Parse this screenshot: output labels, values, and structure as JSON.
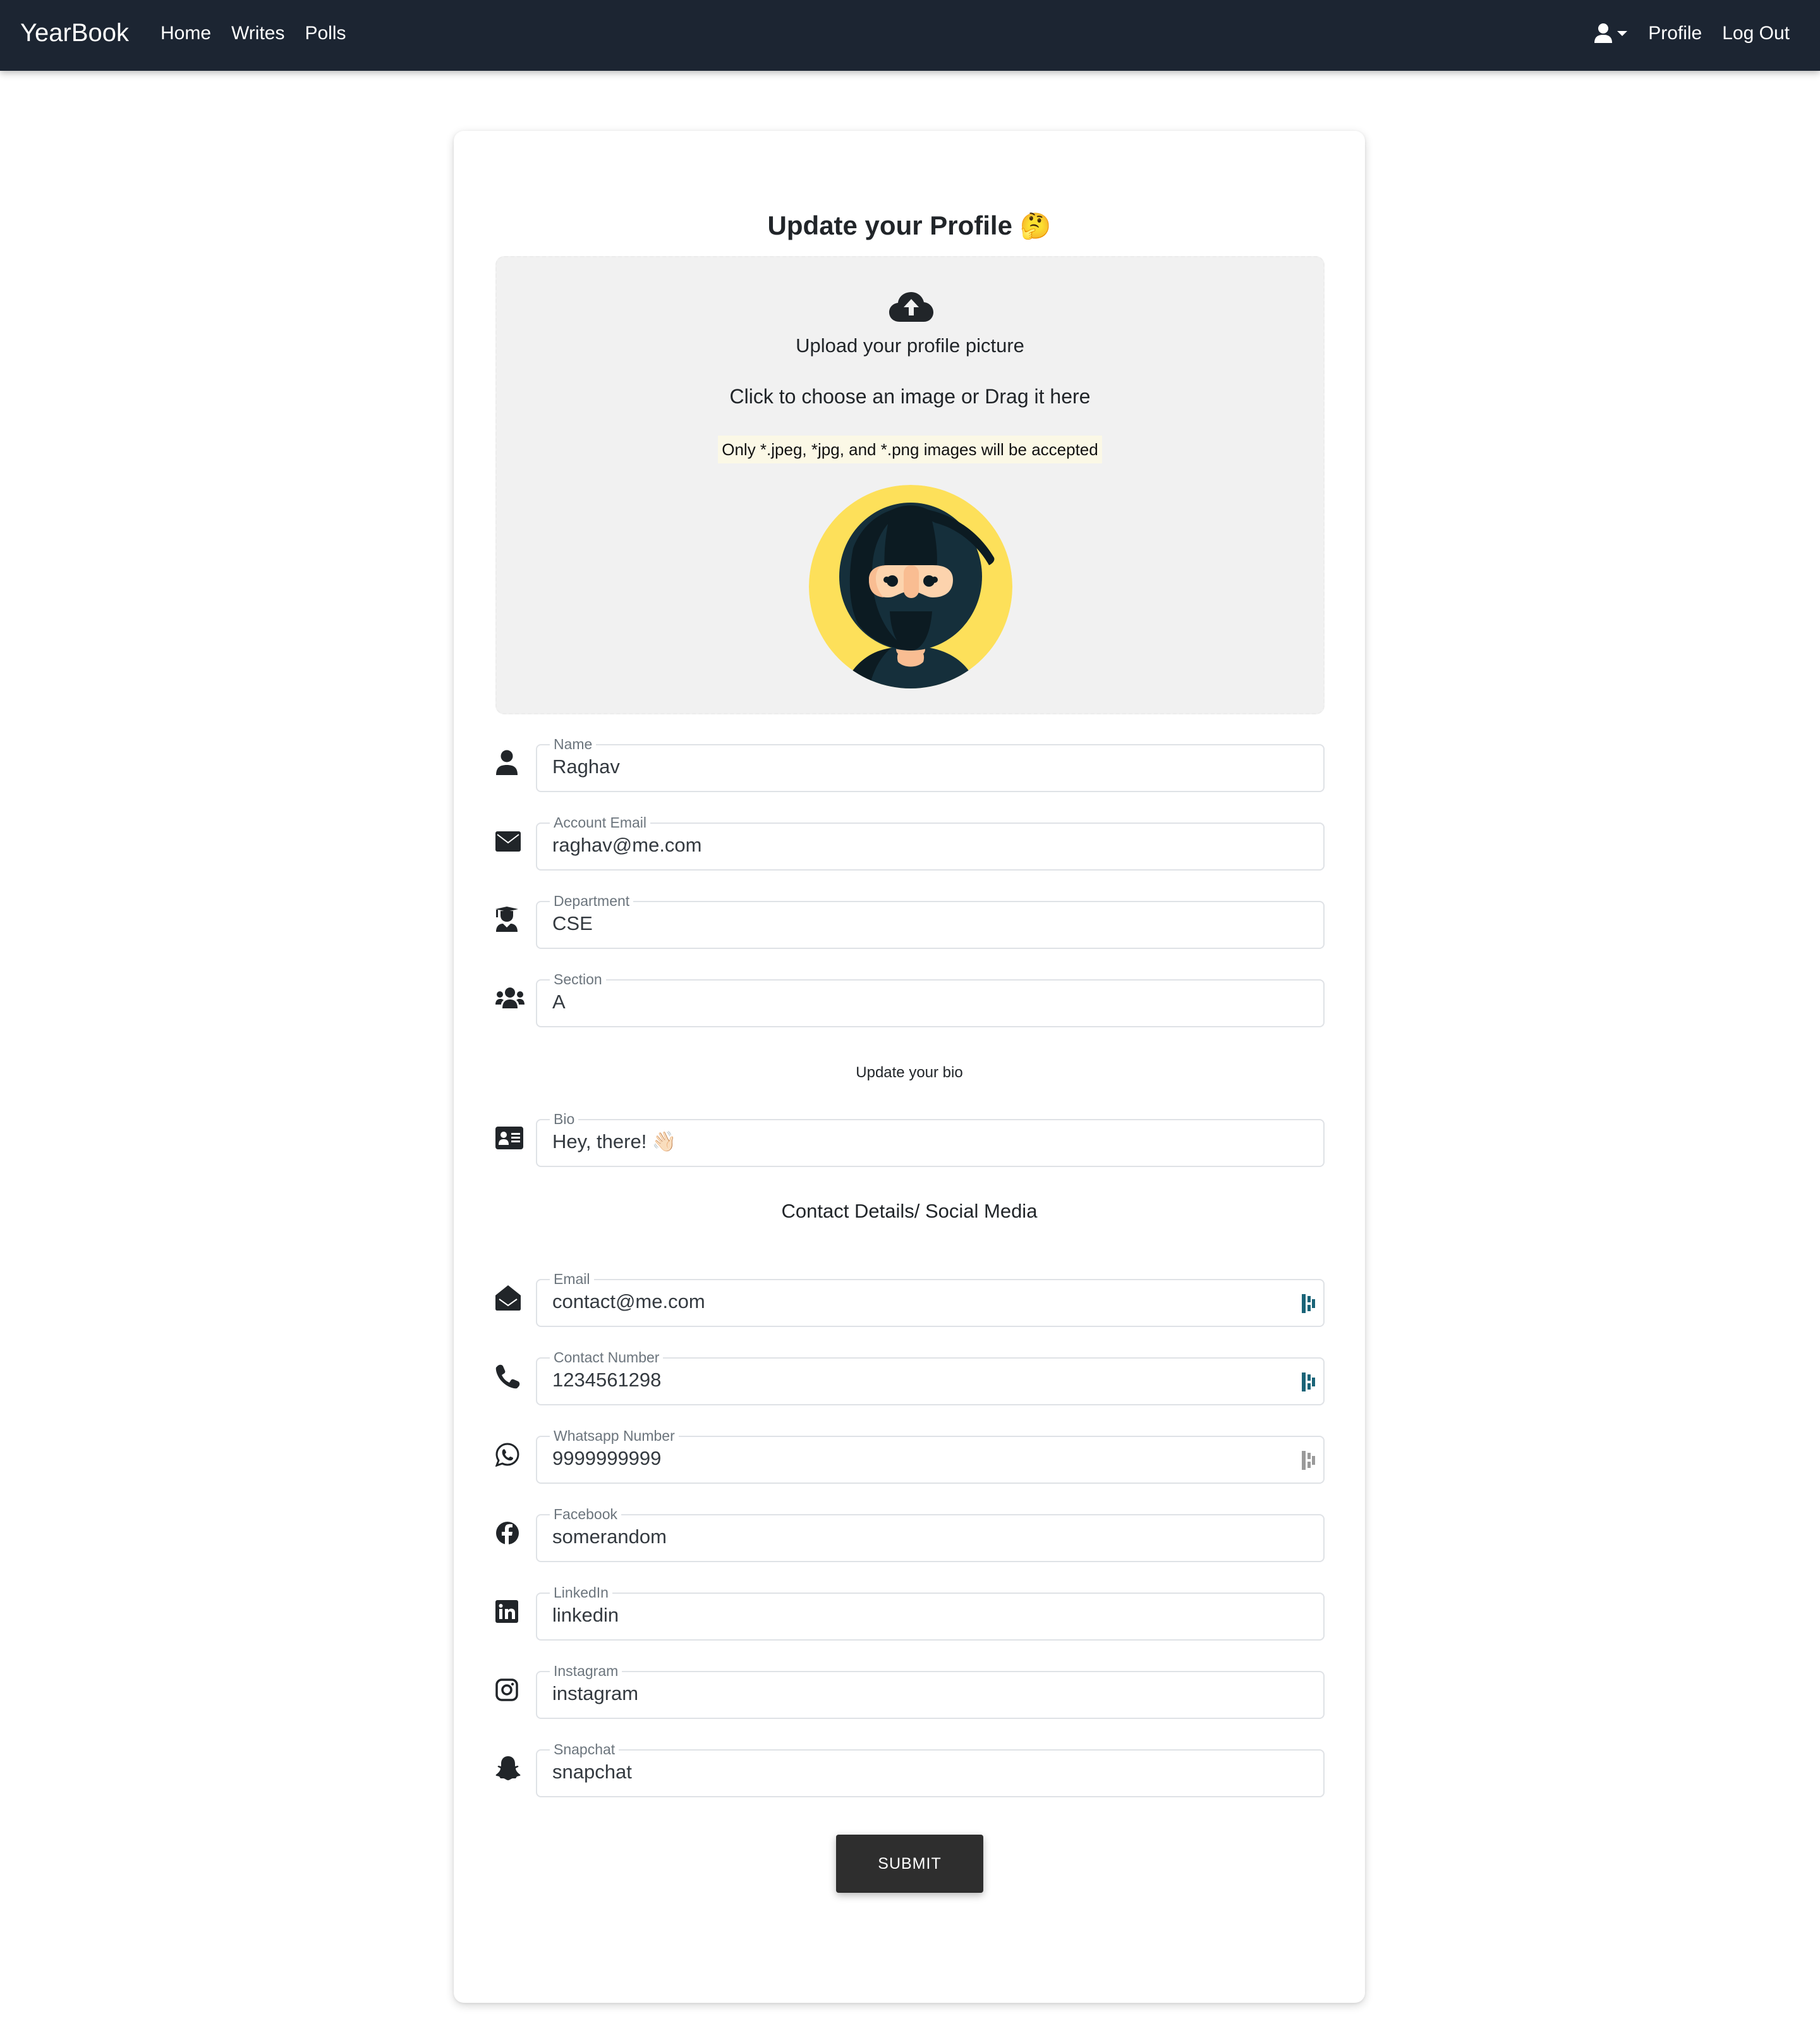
{
  "navbar": {
    "brand": "YearBook",
    "links": [
      {
        "label": "Home"
      },
      {
        "label": "Writes"
      },
      {
        "label": "Polls"
      }
    ],
    "right": {
      "user_icon": "user-icon",
      "dropdown_icon": "caret-down-icon",
      "profile_label": "Profile",
      "logout_label": "Log Out"
    },
    "bg_color": "#1c2532"
  },
  "form": {
    "title": "Update your Profile",
    "title_emoji": "🤔",
    "upload": {
      "icon": "cloud-upload-icon",
      "heading": "Upload your profile picture",
      "instruction": "Click to choose an image or Drag it here",
      "note": "Only *.jpeg, *jpg, and *.png images will be accepted",
      "avatar": "ninja-avatar"
    },
    "basic_fields": [
      {
        "icon": "user-icon",
        "label": "Name",
        "value": "Raghav"
      },
      {
        "icon": "envelope-icon",
        "label": "Account Email",
        "value": "raghav@me.com"
      },
      {
        "icon": "graduate-icon",
        "label": "Department",
        "value": "CSE"
      },
      {
        "icon": "users-icon",
        "label": "Section",
        "value": "A"
      }
    ],
    "bio_heading": "Update your bio",
    "bio_field": {
      "icon": "id-card-icon",
      "label": "Bio",
      "value": "Hey, there! 👋🏻"
    },
    "contact_heading": "Contact Details/ Social Media",
    "contact_fields": [
      {
        "icon": "envelope-open-icon",
        "label": "Email",
        "value": "contact@me.com",
        "extension_icon": "password-manager-icon",
        "extension_color": "#1a6478"
      },
      {
        "icon": "phone-icon",
        "label": "Contact Number",
        "value": "1234561298",
        "extension_icon": "password-manager-icon",
        "extension_color": "#1a6478"
      },
      {
        "icon": "whatsapp-icon",
        "label": "Whatsapp Number",
        "value": "9999999999",
        "extension_icon": "password-manager-icon",
        "extension_color": "#9a9a9a"
      },
      {
        "icon": "facebook-icon",
        "label": "Facebook",
        "value": "somerandom"
      },
      {
        "icon": "linkedin-icon",
        "label": "LinkedIn",
        "value": "linkedin"
      },
      {
        "icon": "instagram-icon",
        "label": "Instagram",
        "value": "instagram"
      },
      {
        "icon": "snapchat-icon",
        "label": "Snapchat",
        "value": "snapchat"
      }
    ],
    "submit_label": "SUBMIT"
  }
}
